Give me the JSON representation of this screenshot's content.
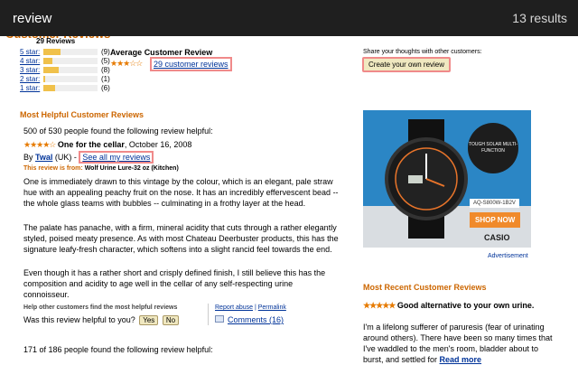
{
  "find_bar": {
    "query": "review",
    "result_count": "13 results"
  },
  "page_header": "Customer Reviews",
  "histogram": {
    "total": "29 Reviews",
    "rows": [
      {
        "label": "5 star:",
        "count": "(9)",
        "fraction": 0.31
      },
      {
        "label": "4 star:",
        "count": "(5)",
        "fraction": 0.17
      },
      {
        "label": "3 star:",
        "count": "(8)",
        "fraction": 0.28
      },
      {
        "label": "2 star:",
        "count": "(1)",
        "fraction": 0.03
      },
      {
        "label": "1 star:",
        "count": "(6)",
        "fraction": 0.21
      }
    ]
  },
  "average": {
    "title": "Average Customer Review",
    "stars": "★★★☆☆",
    "link": "29 customer reviews"
  },
  "share": {
    "text": "Share your thoughts with other customers:",
    "button": "Create your own review"
  },
  "most_helpful": {
    "header": "Most Helpful Customer Reviews",
    "review1": {
      "helpful": "500 of 530 people found the following review helpful:",
      "stars": "★★★★☆",
      "title": "One for the cellar",
      "date": ", October 16, 2008",
      "by": "By ",
      "author": "Twal",
      "location": " (UK) - ",
      "see_all": "See all my reviews",
      "from_label": "This review is from: ",
      "product": "Wolf Urine Lure-32 oz (Kitchen)",
      "p1": "One is immediately drawn to this vintage by the colour, which is an elegant, pale straw hue with an appealing peachy fruit on the nose. It has an incredibly effervescent bead -- the whole glass teams with bubbles -- culminating in a frothy layer at the head.",
      "p2": "The palate has panache, with a firm, mineral acidity that cuts through a rather elegantly styled, poised meaty presence. As with most Chateau Deerbuster products, this has the signature leafy-fresh character, which softens into a slight rancid feel towards the end.",
      "p3": "Even though it has a rather short and crisply defined finish, I still believe this has the composition and acidity to age well in the cellar of any self-respecting urine connoisseur."
    },
    "help_header": "Help other customers find the most helpful reviews",
    "was_helpful": "Was this review helpful to you?",
    "yes": "Yes",
    "no": "No",
    "report": "Report abuse",
    "permalink": "Permalink",
    "comments": "Comments (16)",
    "review2_helpful": "171 of 186 people found the following review helpful:"
  },
  "ad": {
    "badge": "TOUGH SOLAR MULTI-FUNCTION",
    "model": "AQ-S800W-1B2V",
    "shop": "SHOP NOW",
    "brand": "CASIO",
    "advertisement": "Advertisement"
  },
  "most_recent": {
    "header": "Most Recent Customer Reviews",
    "stars": "★★★★★",
    "title": "Good alternative to your own urine.",
    "text": "I'm a lifelong sufferer of paruresis (fear of urinating around others). There have been so many times that I've waddled to the men's room, bladder about to burst, and settled for ",
    "more": "Read more"
  },
  "colors": {
    "accent": "#cc6600",
    "link": "#003399",
    "highlight": "#f08a8a",
    "star": "#e67a00"
  }
}
